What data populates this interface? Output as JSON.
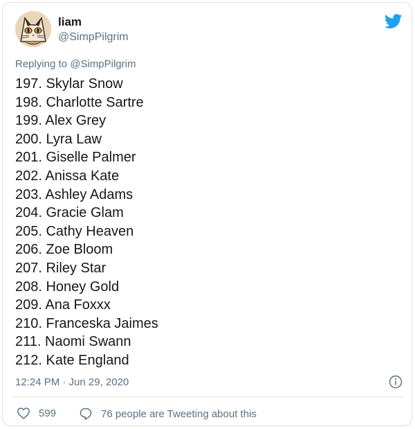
{
  "tweet": {
    "author_name": "liam",
    "author_handle": "@SimpPilgrim",
    "replying_prefix": "Replying to",
    "replying_to": "@SimpPilgrim",
    "lines": [
      "197. Skylar Snow",
      "198. Charlotte Sartre",
      "199. Alex Grey",
      "200. Lyra Law",
      "201. Giselle Palmer",
      "202. Anissa Kate",
      "203. Ashley Adams",
      "204. Gracie Glam",
      "205. Cathy Heaven",
      "206. Zoe Bloom",
      "207. Riley Star",
      "208. Honey Gold",
      "209. Ana Foxxx",
      "210. Franceska Jaimes",
      "211. Naomi Swann",
      "212. Kate England"
    ],
    "timestamp": "12:24 PM · Jun 29, 2020",
    "like_count": "599",
    "talk_text": "76 people are Tweeting about this"
  },
  "icons": {
    "brand": "twitter-bird-icon",
    "info": "info-icon",
    "like": "heart-icon",
    "talk": "speech-bubble-icon"
  },
  "colors": {
    "brand_blue": "#1da1f2",
    "muted_text": "#5b7083",
    "body_text": "#14171a",
    "border": "#d9e0e6"
  }
}
